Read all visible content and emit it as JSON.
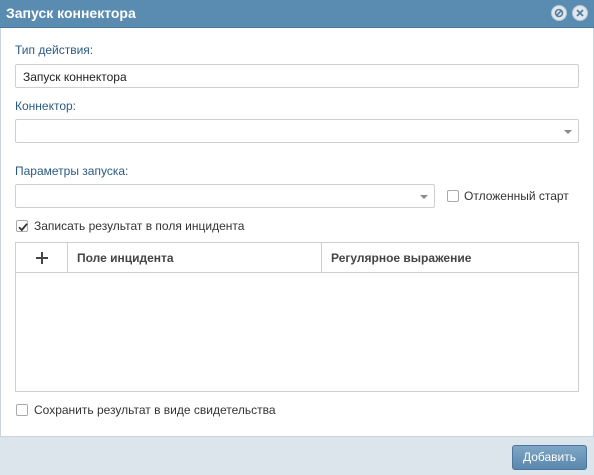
{
  "window": {
    "title": "Запуск коннектора",
    "minimize_icon": "minimize-icon",
    "close_icon": "close-icon"
  },
  "form": {
    "action_type": {
      "label": "Тип действия:",
      "value": "Запуск коннектора"
    },
    "connector": {
      "label": "Коннектор:",
      "value": ""
    },
    "launch_params": {
      "label": "Параметры запуска:",
      "value": ""
    },
    "deferred_start": {
      "label": "Отложенный старт",
      "checked": false
    },
    "write_result": {
      "label": "Записать результат в поля инцидента",
      "checked": true
    },
    "grid": {
      "add_icon": "plus-icon",
      "columns": [
        "Поле инцидента",
        "Регулярное выражение"
      ],
      "rows": []
    },
    "save_evidence": {
      "label": "Сохранить результат в виде свидетельства",
      "checked": false
    }
  },
  "footer": {
    "add_button": "Добавить"
  },
  "colors": {
    "titlebar": "#5a8bb0",
    "label": "#2a5a82",
    "footer": "#dde5ec",
    "button": "#5a87ad"
  }
}
